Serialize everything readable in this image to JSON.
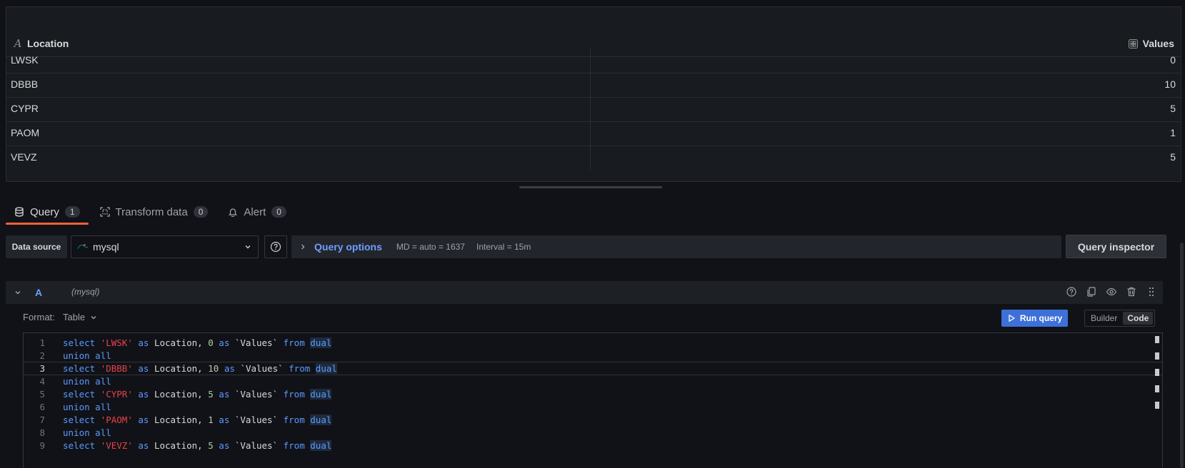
{
  "table": {
    "columns": [
      {
        "label": "Location",
        "icon": "text-field-icon"
      },
      {
        "label": "Values",
        "icon": "number-field-icon"
      }
    ],
    "rows": [
      {
        "location": "LWSK",
        "value": "0"
      },
      {
        "location": "DBBB",
        "value": "10"
      },
      {
        "location": "CYPR",
        "value": "5"
      },
      {
        "location": "PAOM",
        "value": "1"
      },
      {
        "location": "VEVZ",
        "value": "5"
      }
    ]
  },
  "tabs": [
    {
      "label": "Query",
      "count": "1",
      "active": true,
      "icon": "database-icon"
    },
    {
      "label": "Transform data",
      "count": "0",
      "active": false,
      "icon": "transform-icon"
    },
    {
      "label": "Alert",
      "count": "0",
      "active": false,
      "icon": "bell-icon"
    }
  ],
  "toolbar": {
    "data_source_label": "Data source",
    "data_source_value": "mysql",
    "query_options_label": "Query options",
    "md_text": "MD = auto = 1637",
    "interval_text": "Interval = 15m",
    "query_inspector_label": "Query inspector"
  },
  "query": {
    "ref_id": "A",
    "ds_name": "(mysql)",
    "format_label": "Format:",
    "format_value": "Table",
    "run_label": "Run query",
    "mode_builder": "Builder",
    "mode_code": "Code"
  },
  "code_lines": [
    {
      "n": "1",
      "text": "select 'LWSK' as Location, 0 as `Values` from dual"
    },
    {
      "n": "2",
      "text": "union all"
    },
    {
      "n": "3",
      "text": "select 'DBBB' as Location, 10 as `Values` from dual"
    },
    {
      "n": "4",
      "text": "union all"
    },
    {
      "n": "5",
      "text": "select 'CYPR' as Location, 5 as `Values` from dual"
    },
    {
      "n": "6",
      "text": "union all"
    },
    {
      "n": "7",
      "text": "select 'PAOM' as Location, 1 as `Values` from dual"
    },
    {
      "n": "8",
      "text": "union all"
    },
    {
      "n": "9",
      "text": "select 'VEVZ' as Location, 5 as `Values` from dual"
    }
  ],
  "colors": {
    "accent_tab": "#f55f3e",
    "link": "#6e9fff",
    "run_button": "#3d71d9"
  }
}
